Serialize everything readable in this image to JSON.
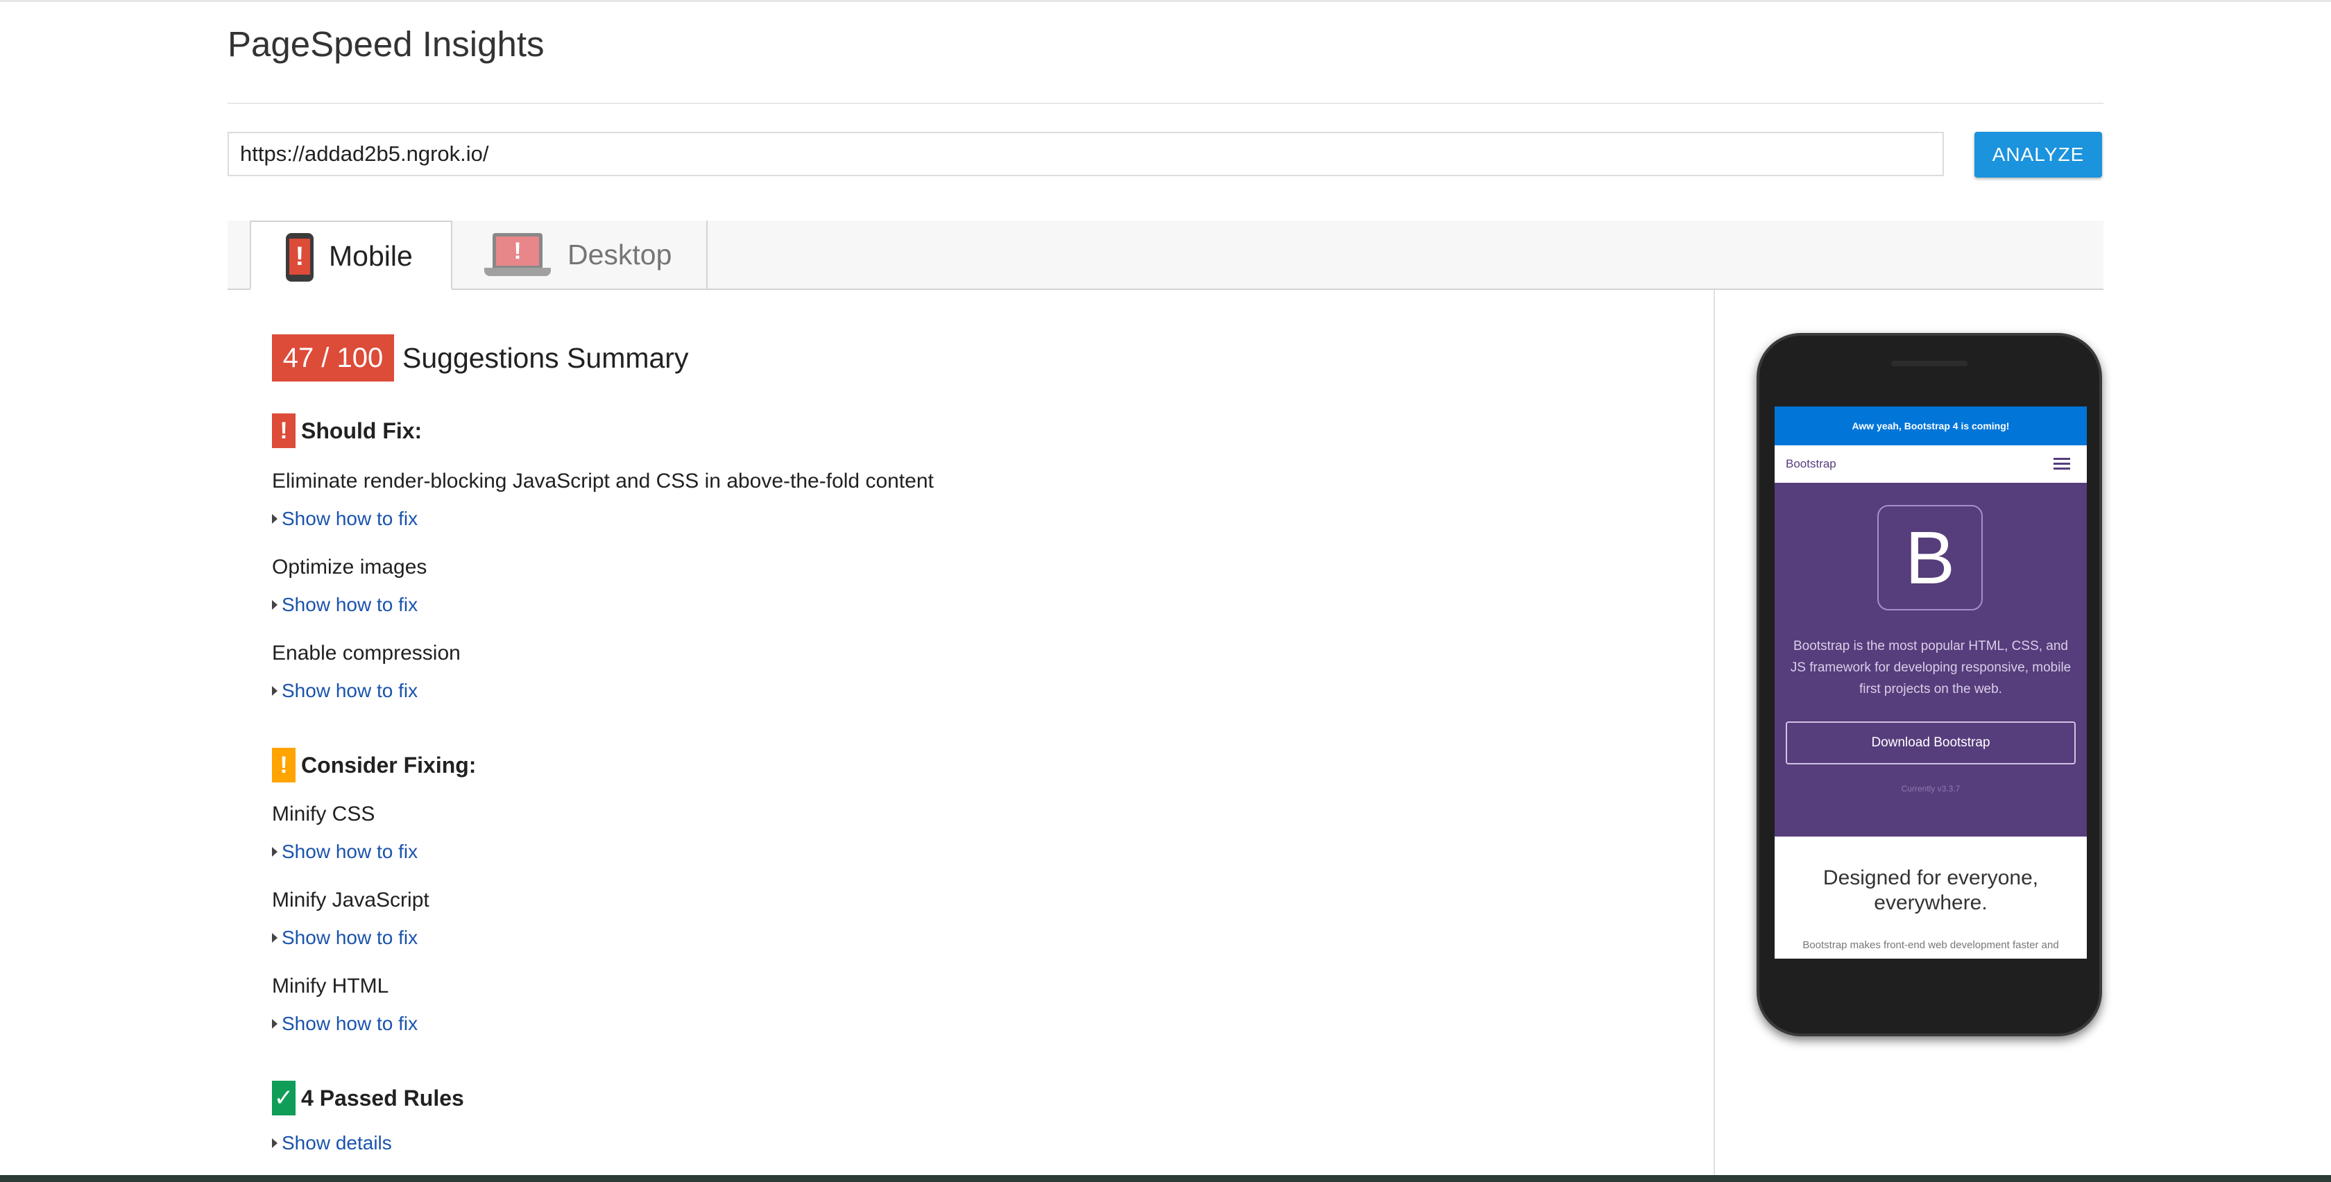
{
  "header": {
    "title": "PageSpeed Insights"
  },
  "search": {
    "url_value": "https://addad2b5.ngrok.io/",
    "analyze_label": "ANALYZE"
  },
  "tabs": [
    {
      "label": "Mobile",
      "icon": "mobile-phone-icon",
      "selected": true
    },
    {
      "label": "Desktop",
      "icon": "laptop-icon",
      "selected": false
    }
  ],
  "results": {
    "score": "47 / 100",
    "summary_title": "Suggestions Summary",
    "should_fix": {
      "badge": "!",
      "heading": "Should Fix:",
      "color": "#dd4b39",
      "rules": [
        {
          "title": "Eliminate render-blocking JavaScript and CSS in above-the-fold content",
          "link": "Show how to fix"
        },
        {
          "title": "Optimize images",
          "link": "Show how to fix"
        },
        {
          "title": "Enable compression",
          "link": "Show how to fix"
        }
      ]
    },
    "consider_fixing": {
      "badge": "!",
      "heading": "Consider Fixing:",
      "color": "#ffa400",
      "rules": [
        {
          "title": "Minify CSS",
          "link": "Show how to fix"
        },
        {
          "title": "Minify JavaScript",
          "link": "Show how to fix"
        },
        {
          "title": "Minify HTML",
          "link": "Show how to fix"
        }
      ]
    },
    "passed": {
      "badge": "✓",
      "heading": "4 Passed Rules",
      "link": "Show details",
      "color": "#0f9d58"
    }
  },
  "preview": {
    "banner": "Aww yeah, Bootstrap 4 is coming!",
    "brand": "Bootstrap",
    "logo_letter": "B",
    "description": "Bootstrap is the most popular HTML, CSS, and JS framework for developing responsive, mobile first projects on the web.",
    "download_label": "Download Bootstrap",
    "current_version": "Currently v3.3.7",
    "heading": "Designed for everyone, everywhere.",
    "paragraph": "Bootstrap makes front-end web development faster and"
  },
  "colors": {
    "accent": "#1b93dd",
    "bootstrap_purple": "#563d7c",
    "link": "#1a53ad"
  }
}
